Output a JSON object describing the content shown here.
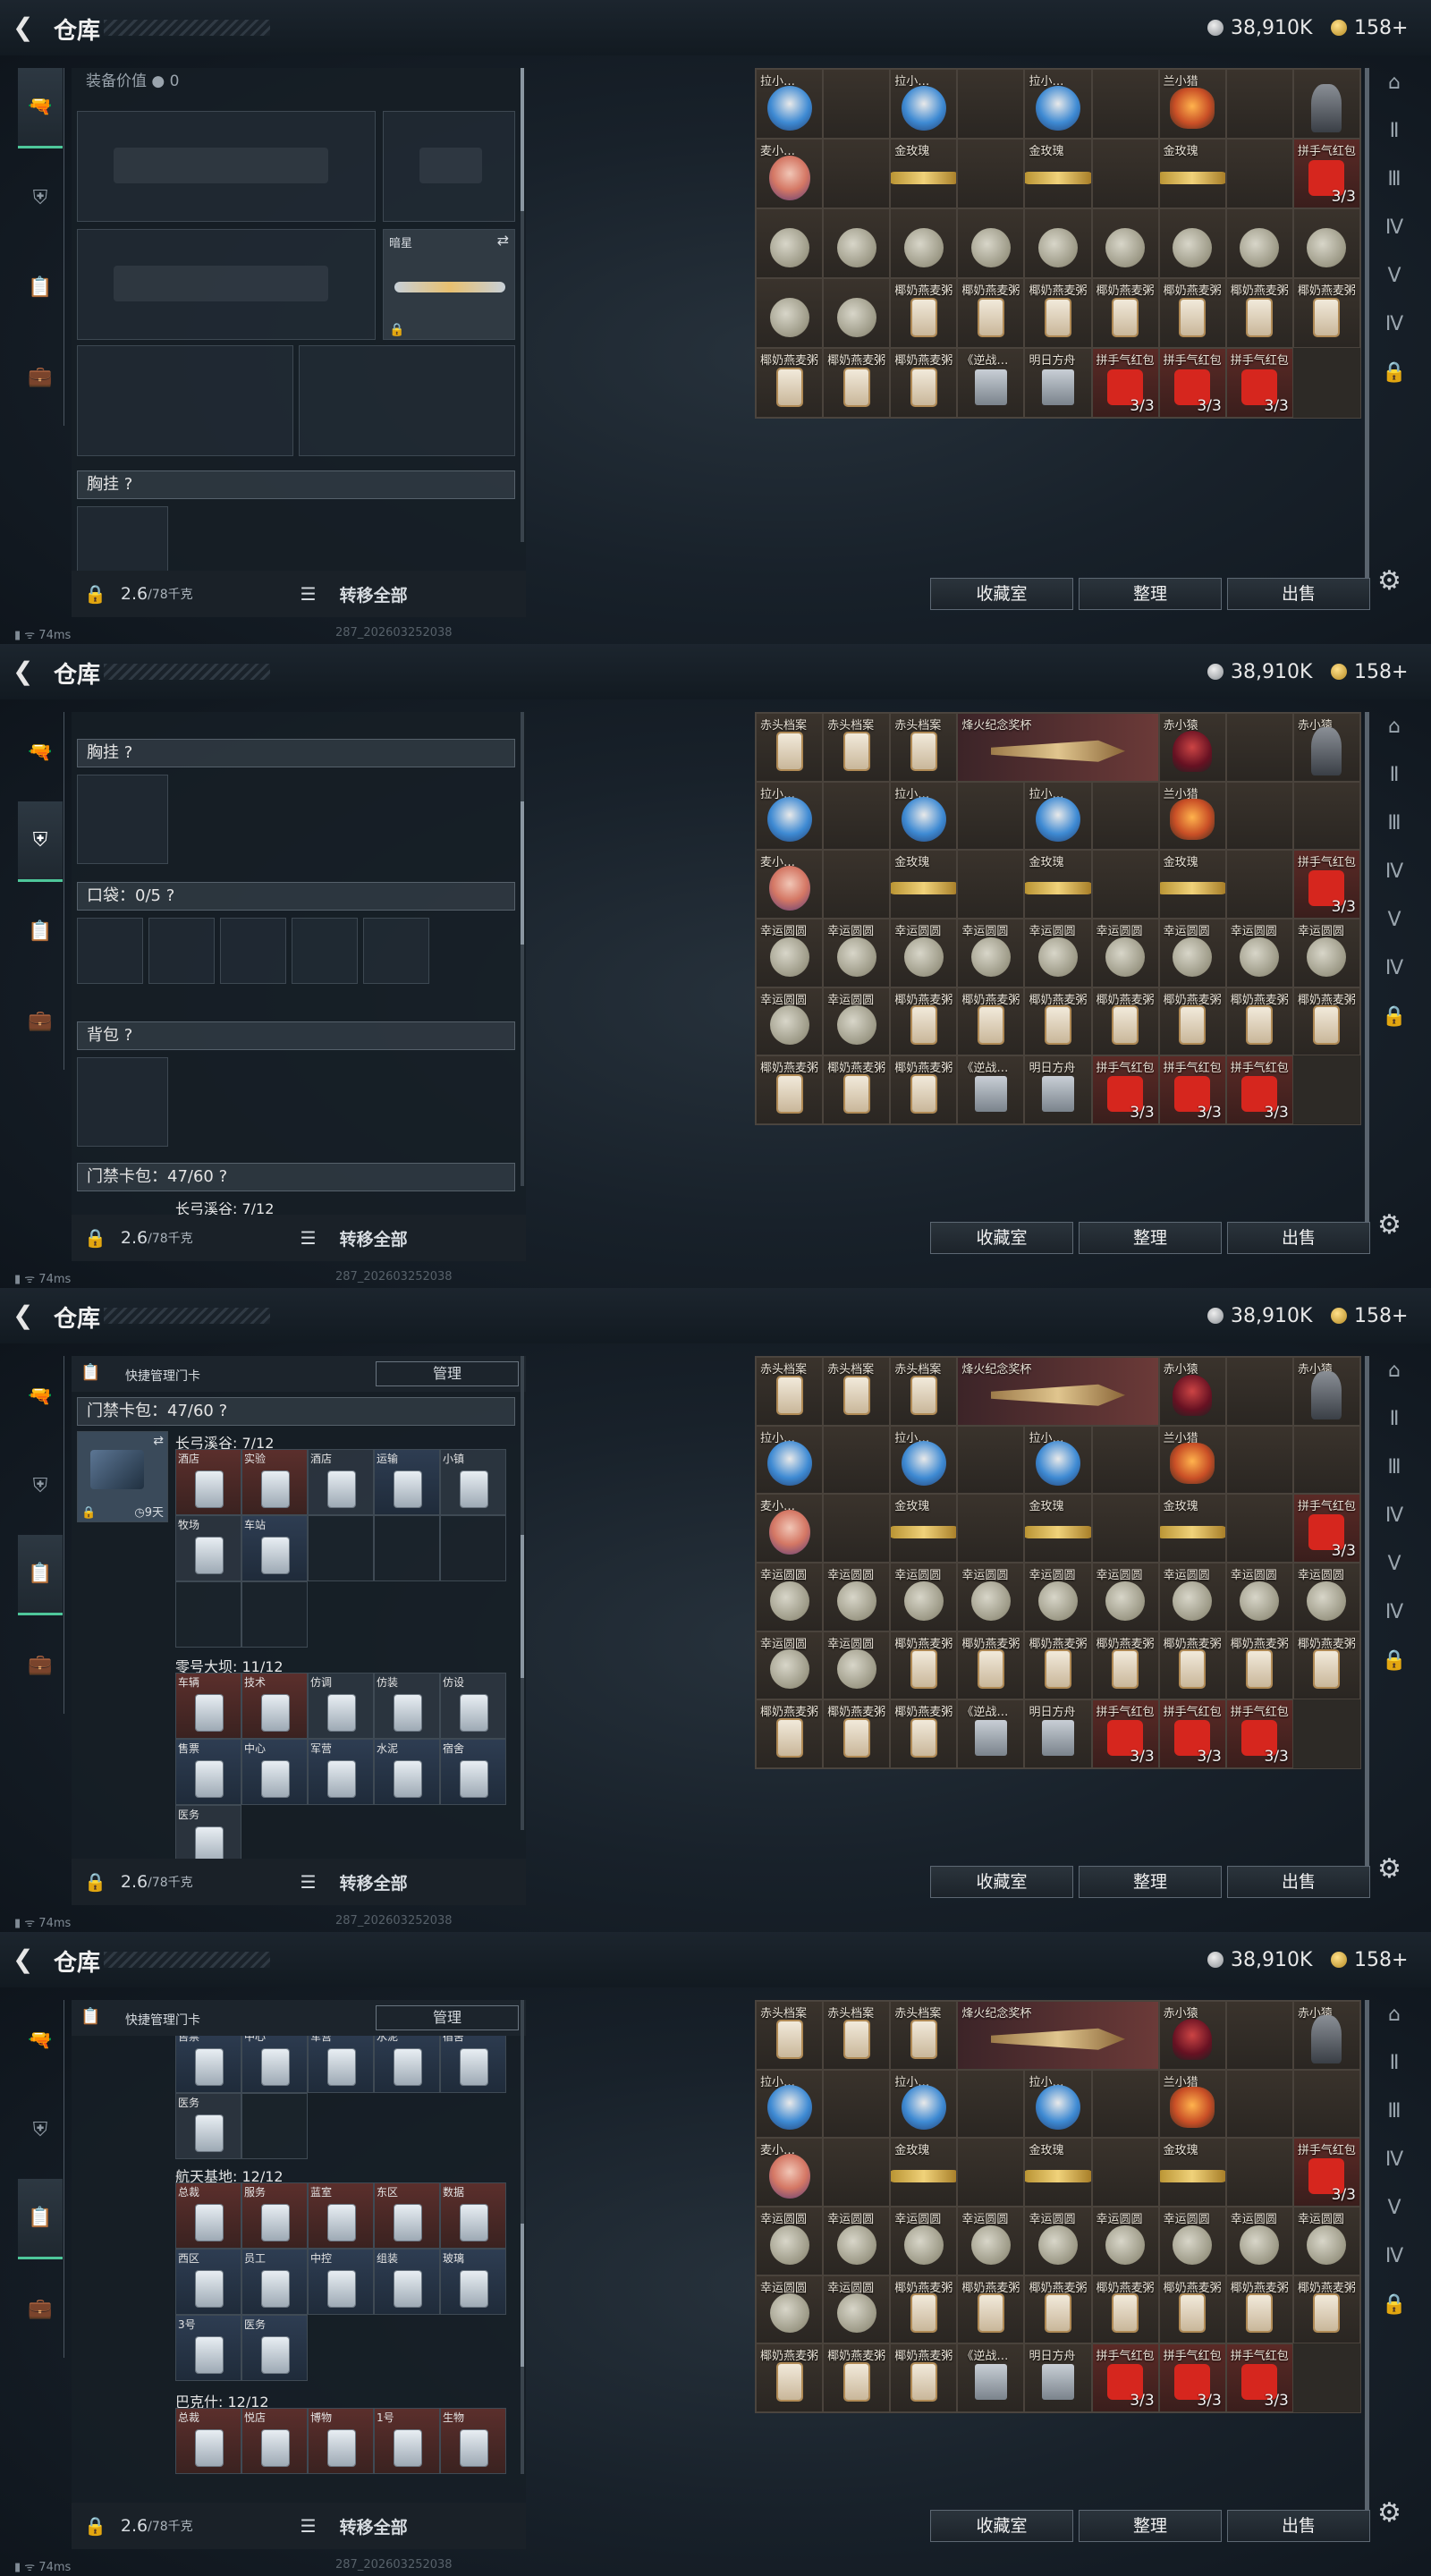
{
  "header": {
    "title": "仓库",
    "silver": "38,910K",
    "gold": "158+"
  },
  "footer": {
    "weight": "2.6",
    "weight_max": "/78千克",
    "transfer_all": "转移全部"
  },
  "actions": {
    "collection": "收藏室",
    "organize": "整理",
    "sell": "出售"
  },
  "status": {
    "ping": "74ms",
    "version": "287_202603252038"
  },
  "panel1": {
    "equip_value": "装备价值",
    "equip_value_num": "0",
    "knife": "暗星",
    "chest": "胸挂 ?"
  },
  "panel2": {
    "chest": "胸挂 ?",
    "pocket": "口袋：0/5 ?",
    "backpack": "背包 ?",
    "keybag": "门禁卡包：47/60 ?",
    "sub": "长弓溪谷: 7/12"
  },
  "panel3": {
    "quick": "快捷管理门卡",
    "manage": "管理",
    "keybag": "门禁卡包：47/60 ?",
    "days": "9天",
    "s1": "长弓溪谷: 7/12",
    "s1cards": [
      "酒店",
      "实验",
      "酒店",
      "运输",
      "小镇"
    ],
    "s1cards2": [
      "牧场",
      "车站"
    ],
    "s2": "零号大坝: 11/12",
    "s2cards": [
      "车辆",
      "技术",
      "仿调",
      "仿装",
      "仿设"
    ],
    "s2cards2": [
      "售票",
      "中心",
      "军营",
      "水泥",
      "宿舍"
    ],
    "s2cards3": [
      "医务"
    ]
  },
  "panel4": {
    "quick": "快捷管理门卡",
    "manage": "管理",
    "top": [
      "售票",
      "中心",
      "军营",
      "水泥",
      "宿舍"
    ],
    "top2": [
      "医务"
    ],
    "s3": "航天基地: 12/12",
    "s3cards": [
      "总裁",
      "服务",
      "蓝室",
      "东区",
      "数据"
    ],
    "s3cards2": [
      "西区",
      "员工",
      "中控",
      "组装",
      "玻璃"
    ],
    "s3cards3": [
      "3号",
      "医务"
    ],
    "s4": "巴克什: 12/12",
    "s4cards": [
      "总裁",
      "悦店",
      "博物",
      "1号",
      "生物"
    ]
  },
  "grid_top": [
    [
      "拉小…",
      "拉小…",
      "拉小…",
      "兰小…"
    ],
    [
      "麦小…",
      "金玫瑰",
      "金玫瑰",
      "金玫瑰",
      "拼手气红包",
      "3/3"
    ],
    [
      "幸运"
    ],
    [
      "椰奶燕麦粥"
    ],
    [
      "椰奶燕麦粥",
      "《逆战…",
      "明日方舟",
      "拼手气红包",
      "3/3"
    ]
  ],
  "grid_full": {
    "row1": [
      "赤头档案",
      "赤头档案",
      "赤头档案",
      "烽火纪念奖杯",
      "赤小猿",
      "赤小猿"
    ],
    "row2": [
      "拉小…",
      "拉小…",
      "拉小…",
      "兰小猎"
    ],
    "row3": [
      "麦小…",
      "金玫瑰",
      "金玫瑰",
      "金玫瑰",
      "拼手气红包"
    ],
    "moon": "幸运圆圆",
    "oat": "椰奶燕麦粥",
    "game1": "《逆战…",
    "game2": "明日方舟",
    "env": "拼手气红包",
    "cnt": "3/3"
  }
}
